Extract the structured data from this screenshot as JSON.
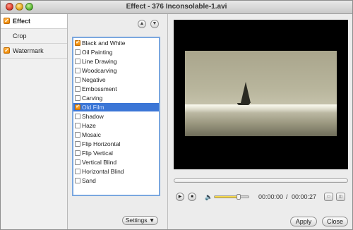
{
  "window": {
    "title": "Effect - 376 Inconsolable-1.avi"
  },
  "sidebar": {
    "items": [
      {
        "label": "Effect",
        "checked": true,
        "active": true
      },
      {
        "label": "Crop",
        "checked": false,
        "active": false
      },
      {
        "label": "Watermark",
        "checked": true,
        "active": false
      }
    ]
  },
  "effects": {
    "items": [
      {
        "label": "Black and White",
        "checked": true,
        "selected": false
      },
      {
        "label": "Oil Painting",
        "checked": false,
        "selected": false
      },
      {
        "label": "Line Drawing",
        "checked": false,
        "selected": false
      },
      {
        "label": "Woodcarving",
        "checked": false,
        "selected": false
      },
      {
        "label": "Negative",
        "checked": false,
        "selected": false
      },
      {
        "label": "Embossment",
        "checked": false,
        "selected": false
      },
      {
        "label": "Carving",
        "checked": false,
        "selected": false
      },
      {
        "label": "Old Film",
        "checked": true,
        "selected": true
      },
      {
        "label": "Shadow",
        "checked": false,
        "selected": false
      },
      {
        "label": "Haze",
        "checked": false,
        "selected": false
      },
      {
        "label": "Mosaic",
        "checked": false,
        "selected": false
      },
      {
        "label": "Flip Horizontal",
        "checked": false,
        "selected": false
      },
      {
        "label": "Flip Vertical",
        "checked": false,
        "selected": false
      },
      {
        "label": "Vertical Blind",
        "checked": false,
        "selected": false
      },
      {
        "label": "Horizontal Blind",
        "checked": false,
        "selected": false
      },
      {
        "label": "Sand",
        "checked": false,
        "selected": false
      }
    ],
    "settings_label": "Settings ▼"
  },
  "player": {
    "current_time": "00:00:00",
    "separator": "/",
    "total_time": "00:00:27",
    "volume": 0.7,
    "progress": 0
  },
  "buttons": {
    "apply": "Apply",
    "close": "Close"
  },
  "colors": {
    "accent_orange": "#f08a00",
    "selection_blue": "#3b76d6",
    "list_border": "#7aa7df"
  }
}
